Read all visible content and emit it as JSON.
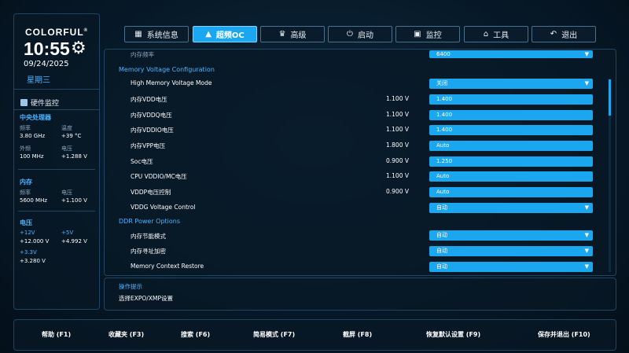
{
  "brand": "COLORFUL",
  "brand_mark": "®",
  "clock": {
    "time": "10:55",
    "date": "09/24/2025",
    "weekday": "星期三"
  },
  "hardware": {
    "title": "硬件监控",
    "cpu": {
      "title": "中央处理器",
      "freq_label": "频率",
      "freq": "3.80 GHz",
      "temp_label": "温度",
      "temp": "+39 °C",
      "bclk_label": "外频",
      "bclk": "100 MHz",
      "volt_label": "电压",
      "volt": "+1.288 V"
    },
    "memory": {
      "title": "内存",
      "freq_label": "频率",
      "freq": "5600 MHz",
      "volt_label": "电压",
      "volt": "+1.100 V"
    },
    "voltage": {
      "title": "电压",
      "v12_label": "+12V",
      "v12": "+12.000 V",
      "v5_label": "+5V",
      "v5": "+4.992 V",
      "v33_label": "+3.3V",
      "v33": "+3.280 V"
    }
  },
  "tabs": [
    {
      "label": "系统信息",
      "icon": "grid-icon"
    },
    {
      "label": "超频OC",
      "icon": "rocket-icon"
    },
    {
      "label": "高级",
      "icon": "crown-icon"
    },
    {
      "label": "启动",
      "icon": "power-icon"
    },
    {
      "label": "监控",
      "icon": "monitor-icon"
    },
    {
      "label": "工具",
      "icon": "toolbox-icon"
    },
    {
      "label": "退出",
      "icon": "back-arrow-icon"
    }
  ],
  "settings": {
    "partial_top": {
      "label": "内存频率",
      "value": "6400"
    },
    "memory_voltage": {
      "title": "Memory Voltage Configuration",
      "rows": [
        {
          "label": "High Memory Voltage Mode",
          "current": "",
          "value": "关闭",
          "dropdown": true
        },
        {
          "label": "内存VDD电压",
          "current": "1.100 V",
          "value": "1.400",
          "dropdown": false
        },
        {
          "label": "内存VDDQ电压",
          "current": "1.100 V",
          "value": "1.400",
          "dropdown": false
        },
        {
          "label": "内存VDDIO电压",
          "current": "1.100 V",
          "value": "1.400",
          "dropdown": false
        },
        {
          "label": "内存VPP电压",
          "current": "1.800 V",
          "value": "Auto",
          "dropdown": false
        },
        {
          "label": "Soc电压",
          "current": "0.900 V",
          "value": "1.250",
          "dropdown": false
        },
        {
          "label": "CPU VDDIO/MC电压",
          "current": "1.100 V",
          "value": "Auto",
          "dropdown": false
        },
        {
          "label": "VDDP电压控制",
          "current": "0.900 V",
          "value": "Auto",
          "dropdown": false
        },
        {
          "label": "VDDG Voltage Control",
          "current": "",
          "value": "自动",
          "dropdown": true
        }
      ]
    },
    "ddr_power": {
      "title": "DDR Power Options",
      "rows": [
        {
          "label": "内存节能模式",
          "current": "",
          "value": "自动",
          "dropdown": true
        },
        {
          "label": "内存寻址加密",
          "current": "",
          "value": "自动",
          "dropdown": true
        },
        {
          "label": "Memory Context Restore",
          "current": "",
          "value": "自动",
          "dropdown": true
        }
      ]
    }
  },
  "hint": {
    "title": "操作提示",
    "text": "选择EXPO/XMP设置"
  },
  "footer": [
    "帮助 (F1)",
    "收藏夹 (F3)",
    "搜索 (F6)",
    "简易模式 (F7)",
    "截屏 (F8)",
    "恢复默认设置 (F9)",
    "保存并退出 (F10)"
  ],
  "colors": {
    "accent": "#1aa7f0",
    "accent_text": "#4fb3ff",
    "background": "#061827"
  }
}
